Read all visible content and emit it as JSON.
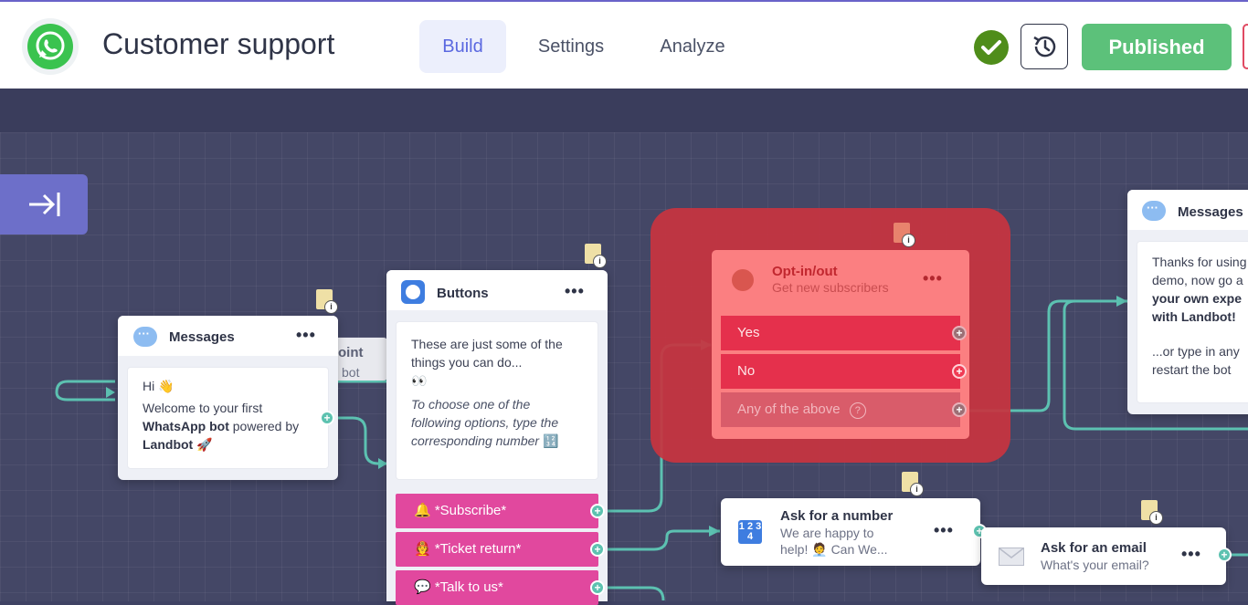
{
  "header": {
    "bot_name": "Customer support",
    "tabs": [
      {
        "label": "Build",
        "active": true
      },
      {
        "label": "Settings",
        "active": false
      },
      {
        "label": "Analyze",
        "active": false
      }
    ],
    "status_icon": "check-circle-icon",
    "history_icon": "history-icon",
    "publish_label": "Published",
    "brand_logo": "whatsapp-icon",
    "colors": {
      "accent": "#5a68e0",
      "publish": "#5cc17a",
      "status_ok": "#4f8d1a"
    }
  },
  "canvas": {
    "collapse_icon": "collapse-arrow-icon",
    "start_tag": {
      "line1": "oint",
      "line2": "bot"
    },
    "nodes": {
      "messages_1": {
        "title": "Messages",
        "menu": "•••",
        "greeting": "Hi 👋",
        "text_pre": "Welcome to your first",
        "text_bold1": "WhatsApp bot",
        "text_mid": "powered by",
        "text_bold2": "Landbot",
        "emoji": "🚀"
      },
      "buttons": {
        "title": "Buttons",
        "menu": "•••",
        "line1": "These are just some of the things you can do...",
        "emoji": "👀",
        "italic_text": "To choose one of the following options, type the corresponding number",
        "italic_emoji": "🔢",
        "options": [
          "🔔 *Subscribe*",
          "🧑‍🚒 *Ticket return*",
          "💬 *Talk to us*"
        ]
      },
      "optin": {
        "title": "Opt-in/out",
        "subtitle": "Get new subscribers",
        "menu": "•••",
        "options": [
          "Yes",
          "No",
          "Any of the above"
        ],
        "help_icon": "question-circle-icon",
        "colors": {
          "node": "#fb7f81",
          "selection": "#c7343f",
          "row": "#e5304c"
        }
      },
      "messages_2": {
        "title": "Messages",
        "text1": "Thanks for using",
        "text2": "demo, now go a",
        "bold1": "your own expe",
        "bold2": "with Landbot!",
        "text3": "...or type in any",
        "text4": "restart the bot"
      },
      "ask_number": {
        "title": "Ask for a number",
        "subtitle1": "We are happy to",
        "subtitle2": "help! 🧑‍💼 Can We...",
        "icon_text": "1 2 3 4",
        "menu": "•••"
      },
      "ask_email": {
        "title": "Ask for an email",
        "subtitle": "What's your email?",
        "menu": "•••"
      }
    }
  }
}
